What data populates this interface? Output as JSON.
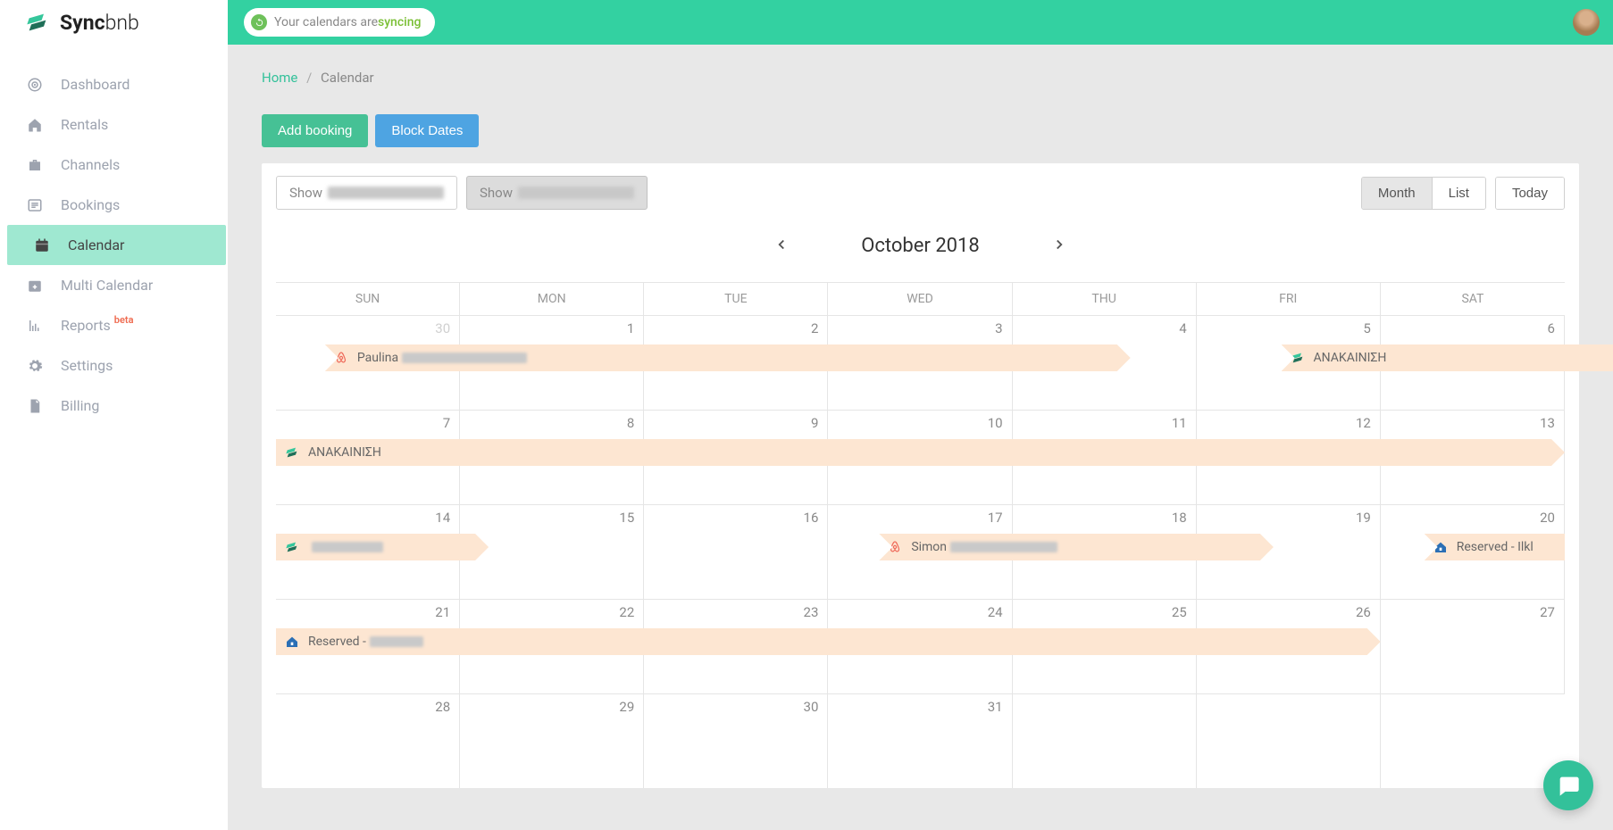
{
  "brand": {
    "bold": "Sync",
    "thin": "bnb"
  },
  "sync_pill": {
    "prefix": "Your calendars are ",
    "status": "syncing"
  },
  "sidebar": {
    "items": [
      {
        "label": "Dashboard"
      },
      {
        "label": "Rentals"
      },
      {
        "label": "Channels"
      },
      {
        "label": "Bookings"
      },
      {
        "label": "Calendar"
      },
      {
        "label": "Multi Calendar"
      },
      {
        "label": "Reports",
        "beta": "beta"
      },
      {
        "label": "Settings"
      },
      {
        "label": "Billing"
      }
    ]
  },
  "breadcrumb": {
    "home": "Home",
    "current": "Calendar"
  },
  "buttons": {
    "add_booking": "Add booking",
    "block_dates": "Block Dates"
  },
  "filters": {
    "show_prefix": "Show"
  },
  "view": {
    "month": "Month",
    "list": "List",
    "today": "Today"
  },
  "month_title": "October 2018",
  "dow": [
    "SUN",
    "MON",
    "TUE",
    "WED",
    "THU",
    "FRI",
    "SAT"
  ],
  "weeks": [
    {
      "days": [
        {
          "n": "30",
          "outside": true
        },
        {
          "n": "1"
        },
        {
          "n": "2"
        },
        {
          "n": "3"
        },
        {
          "n": "4"
        },
        {
          "n": "5"
        },
        {
          "n": "6"
        }
      ],
      "events": [
        {
          "label": "Paulina",
          "icon": "airbnb",
          "startCol": 1,
          "spanPct": 62.5,
          "offsetPct": 3.8,
          "clip": "clip-start-r",
          "has_blur": true,
          "blur_w": 140
        },
        {
          "label": "ΑΝΑΚΑΙΝΙΣΗ",
          "icon": "sync",
          "startCol": 5,
          "spanPct": 28.5,
          "offsetPct": 78,
          "clip": "clip-startonly"
        }
      ]
    },
    {
      "days": [
        {
          "n": "7"
        },
        {
          "n": "8"
        },
        {
          "n": "9"
        },
        {
          "n": "10"
        },
        {
          "n": "11"
        },
        {
          "n": "12"
        },
        {
          "n": "13"
        }
      ],
      "events": [
        {
          "label": "ΑΝΑΚΑΙΝΙΣΗ",
          "icon": "sync",
          "startCol": 0,
          "spanPct": 100,
          "offsetPct": 0,
          "clip": "clip-slab"
        }
      ]
    },
    {
      "days": [
        {
          "n": "14"
        },
        {
          "n": "15"
        },
        {
          "n": "16"
        },
        {
          "n": "17"
        },
        {
          "n": "18"
        },
        {
          "n": "19"
        },
        {
          "n": "20"
        }
      ],
      "events": [
        {
          "label": "",
          "icon": "sync",
          "startCol": 0,
          "spanPct": 16.5,
          "offsetPct": 0,
          "clip": "clip-slab",
          "has_blur": true,
          "blur_w": 80
        },
        {
          "label": "Simon",
          "icon": "airbnb",
          "startCol": 2,
          "spanPct": 30.6,
          "offsetPct": 46.8,
          "clip": "clip-start-r",
          "has_blur": true,
          "blur_w": 120
        },
        {
          "label": "Reserved - Ilkl",
          "icon": "homeaway",
          "startCol": 6,
          "spanPct": 10.9,
          "offsetPct": 89.1,
          "clip": "clip-startonly"
        }
      ]
    },
    {
      "days": [
        {
          "n": "21"
        },
        {
          "n": "22"
        },
        {
          "n": "23"
        },
        {
          "n": "24"
        },
        {
          "n": "25"
        },
        {
          "n": "26"
        },
        {
          "n": "27"
        }
      ],
      "events": [
        {
          "label": "Reserved - ",
          "icon": "homeaway",
          "startCol": 0,
          "spanPct": 85.7,
          "offsetPct": 0,
          "clip": "clip-slab",
          "has_blur": true,
          "blur_w": 60
        }
      ]
    },
    {
      "days": [
        {
          "n": "28"
        },
        {
          "n": "29"
        },
        {
          "n": "30"
        },
        {
          "n": "31"
        },
        {
          "n": ""
        },
        {
          "n": ""
        },
        {
          "n": ""
        }
      ],
      "events": []
    }
  ]
}
